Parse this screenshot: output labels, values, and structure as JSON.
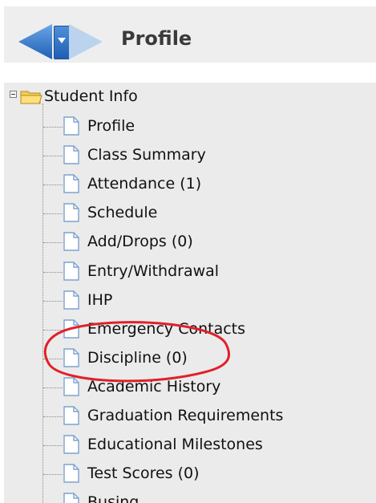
{
  "header": {
    "title": "Profile",
    "back_icon": "back-arrow-icon",
    "menu_icon": "dropdown-arrow-icon",
    "forward_icon": "forward-arrow-icon"
  },
  "tree": {
    "root": {
      "label": "Student Info",
      "expanded": true,
      "icon": "folder-open-icon"
    },
    "items": [
      {
        "label": "Profile",
        "icon": "document-icon"
      },
      {
        "label": "Class Summary",
        "icon": "document-icon"
      },
      {
        "label": "Attendance (1)",
        "icon": "document-icon"
      },
      {
        "label": "Schedule",
        "icon": "document-icon"
      },
      {
        "label": "Add/Drops (0)",
        "icon": "document-icon"
      },
      {
        "label": "Entry/Withdrawal",
        "icon": "document-icon"
      },
      {
        "label": "IHP",
        "icon": "document-icon"
      },
      {
        "label": "Emergency Contacts",
        "icon": "document-icon"
      },
      {
        "label": "Discipline (0)",
        "icon": "document-icon"
      },
      {
        "label": "Academic History",
        "icon": "document-icon"
      },
      {
        "label": "Graduation Requirements",
        "icon": "document-icon"
      },
      {
        "label": "Educational Milestones",
        "icon": "document-icon"
      },
      {
        "label": "Test Scores (0)",
        "icon": "document-icon"
      },
      {
        "label": "Busing",
        "icon": "document-icon"
      }
    ]
  },
  "annotation": {
    "shape": "ellipse",
    "color": "#e0202a",
    "highlights": "Discipline (0)"
  }
}
